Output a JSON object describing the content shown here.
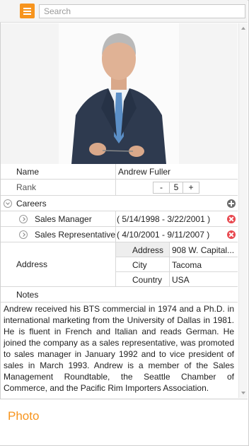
{
  "toolbar": {
    "menu_icon": "hamburger-menu-icon",
    "accent_color": "#f7941d",
    "search_placeholder": "Search"
  },
  "employee": {
    "name_label": "Name",
    "name_value": "Andrew Fuller",
    "rank_label": "Rank",
    "rank_minus": "-",
    "rank_value": "5",
    "rank_plus": "+",
    "careers_label": "Careers",
    "careers": [
      {
        "title": "Sales Manager",
        "period": "( 5/14/1998 - 3/22/2001 )"
      },
      {
        "title": "Sales Representative",
        "period": "( 4/10/2001 - 9/11/2007 )"
      }
    ],
    "address_label": "Address",
    "address": {
      "address_label": "Address",
      "address_value": "908 W. Capital...",
      "city_label": "City",
      "city_value": "Tacoma",
      "country_label": "Country",
      "country_value": "USA"
    },
    "notes_label": "Notes",
    "notes_text": "Andrew received his BTS commercial in 1974 and a Ph.D. in international marketing from the University of Dallas in 1981. He is fluent in French and Italian and reads German. He joined the company as a sales representative, was promoted to sales manager in January 1992 and to vice president of sales in March 1993. Andrew is a member of the Sales Management Roundtable, the Seattle Chamber of Commerce, and the Pacific Rim Importers Association."
  },
  "bottom_panel": {
    "title": "Photo"
  }
}
